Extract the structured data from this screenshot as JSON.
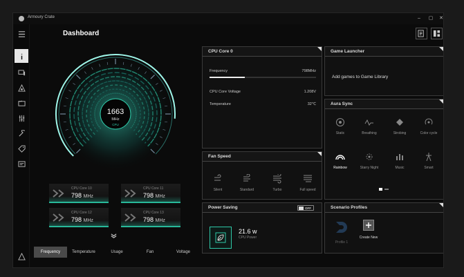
{
  "app": {
    "title": "Armoury Crate"
  },
  "window_controls": {
    "minimize": "–",
    "maximize": "▢",
    "close": "✕"
  },
  "page": {
    "title": "Dashboard"
  },
  "gauge": {
    "value": "1663",
    "unit": "MHz",
    "label": "CPU",
    "fraction": 0.85
  },
  "cores": [
    {
      "label": "CPU Core 10",
      "value": "798",
      "unit": "MHz"
    },
    {
      "label": "CPU Core 11",
      "value": "798",
      "unit": "MHz"
    },
    {
      "label": "CPU Core 12",
      "value": "798",
      "unit": "MHz"
    },
    {
      "label": "CPU Core 13",
      "value": "798",
      "unit": "MHz"
    }
  ],
  "tabs": [
    "Frequency",
    "Temperature",
    "Usage",
    "Fan",
    "Voltage"
  ],
  "cpu_core_panel": {
    "title": "CPU Core 0",
    "frequency_label": "Frequency",
    "frequency_value": "798MHz",
    "frequency_fraction": 0.33,
    "voltage_label": "CPU Core Voltage",
    "voltage_value": "1.208V",
    "temperature_label": "Temperature",
    "temperature_value": "32℃"
  },
  "fan_speed": {
    "title": "Fan Speed",
    "modes": [
      "Silent",
      "Standard",
      "Turbo",
      "Full speed"
    ]
  },
  "power_saving": {
    "title": "Power Saving",
    "toggle_label": "OFF",
    "value": "21.6 w",
    "label": "CPU Power"
  },
  "game_launcher": {
    "title": "Game Launcher",
    "message": "Add games to Game Library"
  },
  "aura_sync": {
    "title": "Aura Sync",
    "effects": [
      "Static",
      "Breathing",
      "Strobing",
      "Color cycle",
      "Rainbow",
      "Starry Night",
      "Music",
      "Smart"
    ],
    "active": "Rainbow"
  },
  "scenario_profiles": {
    "title": "Scenario Profiles",
    "profile_label": "Profile 1",
    "create_label": "Create New"
  },
  "colors": {
    "accent": "#2fc9a8",
    "panel_border": "#3a3a3a",
    "background": "#0b0b0b"
  }
}
